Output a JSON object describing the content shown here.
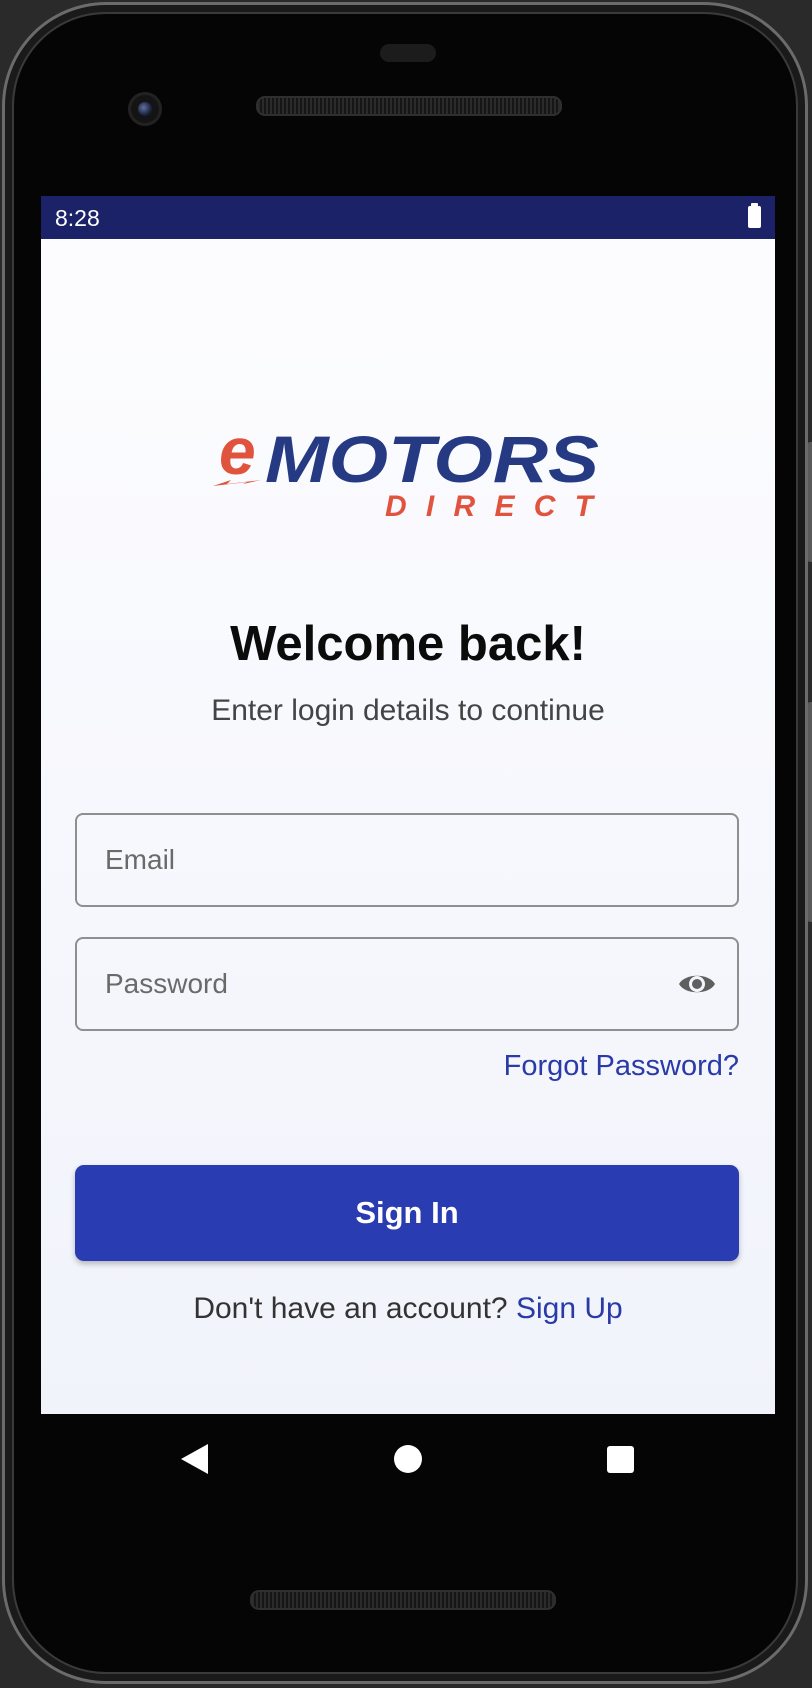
{
  "status_bar": {
    "time": "8:28"
  },
  "logo": {
    "line1_prefix": "e",
    "line1_main": "MOTORS",
    "line2": "DIRECT",
    "primary_color": "#263a83",
    "accent_color": "#e0533c"
  },
  "header": {
    "title": "Welcome back!",
    "subtitle": "Enter login details to continue"
  },
  "form": {
    "email_placeholder": "Email",
    "password_placeholder": "Password",
    "password_toggle_icon": "eye-icon",
    "forgot_password": "Forgot Password?",
    "sign_in_label": "Sign In"
  },
  "footer": {
    "prompt": "Don't have an account?",
    "sign_up_link": "Sign Up"
  },
  "colors": {
    "status_bar": "#1b2268",
    "button": "#2a3cb1",
    "link": "#2a3aa8"
  },
  "nav_bar": {
    "icons": [
      "back-icon",
      "home-icon",
      "recents-icon"
    ]
  }
}
